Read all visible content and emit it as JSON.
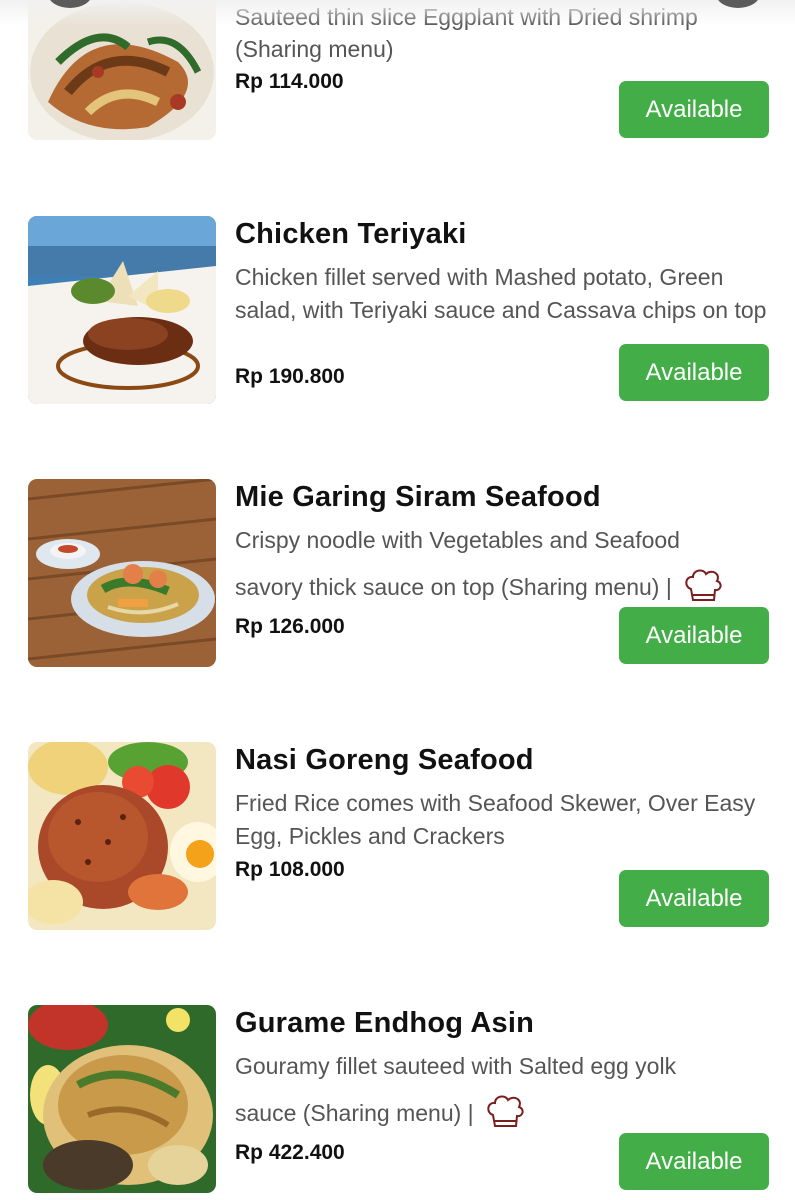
{
  "accent_color": "#43ad48",
  "chef_hat_icon": "chef-hat-icon",
  "items": [
    {
      "title": "",
      "desc1": "Sauteed thin slice Eggplant with Dried shrimp",
      "desc2": "(Sharing menu)",
      "price": "Rp 114.000",
      "button": "Available"
    },
    {
      "title": "Chicken Teriyaki",
      "desc": "Chicken fillet served with Mashed potato, Green salad, with Teriyaki sauce and Cassava chips on top",
      "price": "Rp 190.800",
      "button": "Available"
    },
    {
      "title": "Mie Garing Siram Seafood",
      "desc1": "Crispy noodle with Vegetables and Seafood",
      "desc2": "savory thick sauce on top (Sharing menu) |",
      "price": "Rp 126.000",
      "button": "Available"
    },
    {
      "title": "Nasi Goreng Seafood",
      "desc": "Fried Rice comes with Seafood Skewer, Over Easy Egg, Pickles and Crackers",
      "price": "Rp 108.000",
      "button": "Available"
    },
    {
      "title": "Gurame Endhog Asin",
      "desc1": "Gouramy fillet sauteed with Salted egg yolk",
      "desc2": "sauce (Sharing menu) |",
      "price": "Rp 422.400",
      "button": "Available"
    }
  ]
}
